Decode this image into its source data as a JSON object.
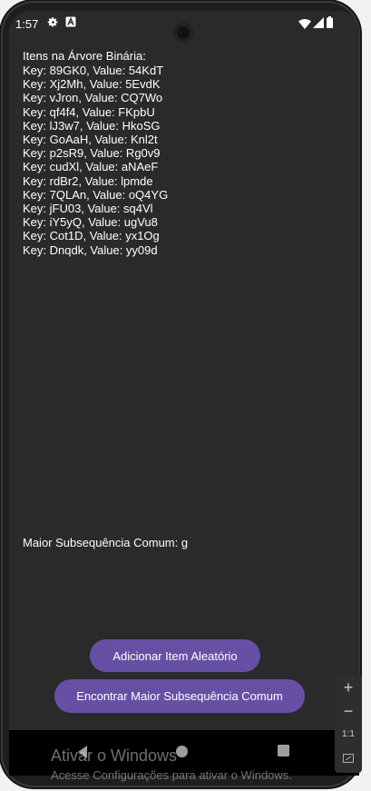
{
  "status_bar": {
    "time": "1:57",
    "icons": [
      "settings-gear-icon",
      "a-box-icon",
      "wifi-icon",
      "cellular-signal-icon",
      "battery-icon"
    ]
  },
  "content": {
    "items_heading": "Itens na Árvore Binária:",
    "items": [
      "Key: 89GK0, Value: 54KdT",
      "Key: Xj2Mh, Value: 5EvdK",
      "Key: vJron, Value: CQ7Wo",
      "Key: qf4f4, Value: FKpbU",
      "Key: lJ3w7, Value: HkoSG",
      "Key: GoAaH, Value: Knl2t",
      "Key: p2sR9, Value: Rg0v9",
      "Key: cudXl, Value: aNAeF",
      "Key: rdBr2, Value: lpmde",
      "Key: 7QLAn, Value: oQ4YG",
      "Key: jFU03, Value: sq4Vl",
      "Key: iY5yQ, Value: ugVu8",
      "Key: Cot1D, Value: yx1Og",
      "Key: Dnqdk, Value: yy09d"
    ],
    "lcs_result": "Maior Subsequência Comum: g"
  },
  "buttons": {
    "add_random": "Adicionar Item Aleatório",
    "find_lcs": "Encontrar Maior Subsequência Comum"
  },
  "zoom_controls": {
    "zoom_in": "+",
    "zoom_out": "−",
    "one_to_one": "1:1"
  },
  "watermark": {
    "title": "Ativar o Windows",
    "subtitle": "Acesse Configurações para ativar o Windows."
  },
  "colors": {
    "screen_background": "#2a2a2a",
    "button_background": "#6650a4",
    "text": "#ffffff"
  }
}
